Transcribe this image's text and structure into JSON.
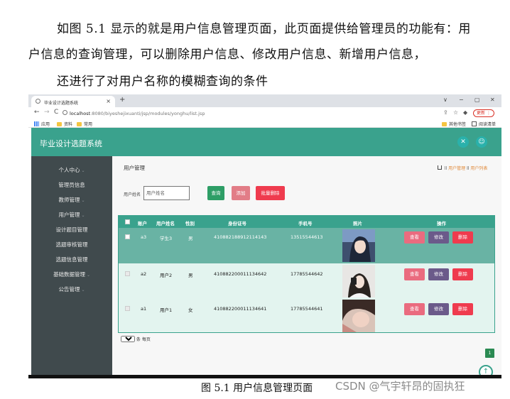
{
  "text": {
    "line1": "如图 5.1 显示的就是用户信息管理页面，此页面提供给管理员的功能有：用",
    "line2": "户信息的查询管理，可以删除用户信息、修改用户信息、新增用户信息，",
    "line3": "还进行了对用户名称的模糊查询的条件",
    "caption": "图 5.1  用户信息管理页面",
    "watermark": "CSDN @气宇轩昂的固执狂"
  },
  "browser": {
    "tab_title": "毕业设计选题系统",
    "close": "×",
    "new_tab": "+",
    "window_controls": [
      "∨",
      "−",
      "▢",
      "✕"
    ],
    "nav_buttons": [
      "←",
      "→",
      "C"
    ],
    "url_host": "localhost",
    "url_rest": ":8080/biyeshejixuanti/jsp/modules/yonghu/list.jsp",
    "right_icons": [
      "⇪",
      "☆",
      "◆",
      "●"
    ],
    "update_label": "更新 ⋮",
    "bookmarks": [
      "应用",
      "资料",
      "常用"
    ],
    "bookmarks_right": [
      "其他书签",
      "阅读清单"
    ]
  },
  "app": {
    "title": "毕业设计选题系统",
    "header_icons": [
      "✕",
      "☺"
    ],
    "sidebar": [
      {
        "label": "个人中心",
        "caret": "⌄"
      },
      {
        "label": "管理员信息",
        "caret": ""
      },
      {
        "label": "教师管理",
        "caret": "⌄"
      },
      {
        "label": "用户管理",
        "caret": "⌄"
      },
      {
        "label": "设计题目管理",
        "caret": ""
      },
      {
        "label": "选题审核管理",
        "caret": ""
      },
      {
        "label": "选题信息管理",
        "caret": ""
      },
      {
        "label": "基础数据管理",
        "caret": "⌄"
      },
      {
        "label": "公告管理",
        "caret": "⌄"
      }
    ],
    "page_title": "用户管理",
    "breadcrumb": {
      "sep1": " ll ",
      "item1": "用户管理",
      "sep2": " ll ",
      "item2": "用户列表"
    },
    "search": {
      "label": "用户姓名",
      "placeholder": "用户姓名"
    },
    "buttons": {
      "query": "查询",
      "add": "添加",
      "batch_delete": "批量删除"
    },
    "table": {
      "headers": [
        "账户",
        "用户姓名",
        "性别",
        "身份证号",
        "手机号",
        "照片",
        "操作"
      ],
      "rows": [
        {
          "account": "a3",
          "name": "学生3",
          "gender": "男",
          "id_card": "410882188912114143",
          "phone": "13515544613"
        },
        {
          "account": "a2",
          "name": "用户2",
          "gender": "男",
          "id_card": "410882200011134642",
          "phone": "17785544642"
        },
        {
          "account": "a1",
          "name": "用户1",
          "gender": "女",
          "id_card": "410882200011134641",
          "phone": "17785544641"
        }
      ],
      "actions": {
        "view": "查看",
        "edit": "修改",
        "delete": "删除"
      }
    },
    "pager": {
      "page_size": "10",
      "per_page_text": "条 每页",
      "current_page": "1"
    },
    "scroll_top_icon": "↑"
  },
  "colors": {
    "primary": "#3aa28d",
    "sidebar": "#404a4d",
    "query_button": "#2e9e66",
    "add_button": "#e27d87",
    "delete_button": "#ef3b4e",
    "view_button": "#ea6b7f",
    "edit_button": "#6b5a8a"
  }
}
